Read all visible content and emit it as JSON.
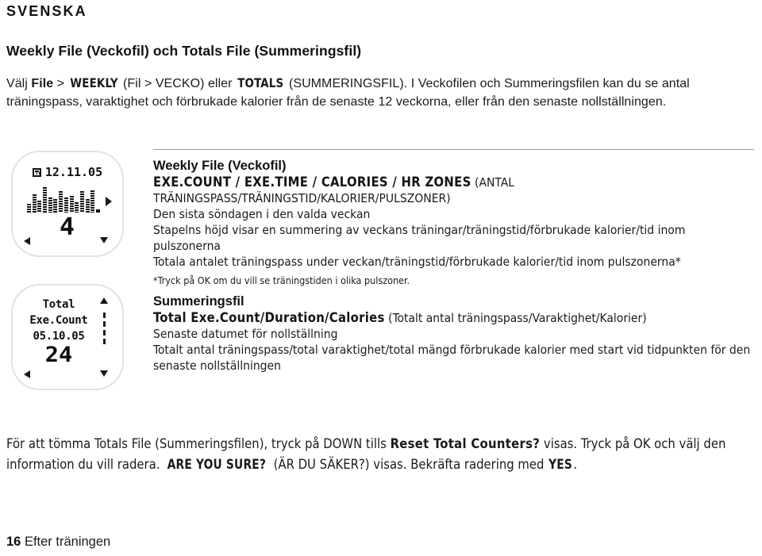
{
  "language_header": "SVENSKA",
  "section_title": "Weekly File (Veckofil) och Totals File (Summeringsfil)",
  "intro": {
    "p1_a": "Välj ",
    "p1_file": "File",
    "p1_gt": " > ",
    "p1_weekly": "WEEKLY",
    "p1_b": " (Fil > VECKO) eller ",
    "p1_totals": "TOTALS",
    "p1_c": " (SUMMERINGSFIL). I Veckofilen och Summeringsfilen kan du se antal träningspass, varaktighet och förbrukade kalorier från de senaste 12 veckorna, eller från den senaste nollställningen."
  },
  "watch_weekly": {
    "date": "12.11.05",
    "calendar_icon": "calendar-icon",
    "value": "4",
    "left_arrow_icon": "arrow-left-icon",
    "down_arrow_icon": "arrow-down-icon",
    "right_arrow_icon": "arrow-right-icon",
    "bars": [
      8,
      17,
      11,
      24,
      14,
      13,
      20,
      14,
      16,
      10,
      20,
      13,
      21,
      3
    ]
  },
  "watch_totals": {
    "line1": "Total",
    "line2": "Exe.Count",
    "line3": "05.10.05",
    "value": "24",
    "up_arrow_icon": "arrow-up-icon",
    "down_arrow_icon": "arrow-down-icon",
    "left_arrow_icon": "arrow-left-icon",
    "scroll_indicator": "scroll-dots"
  },
  "weekly_block": {
    "heading": "Weekly File (Veckofil)",
    "modes": "EXE.COUNT / EXE.TIME / CALORIES / HR ZONES",
    "modes_translation_1": " (ANTAL",
    "modes_translation_2": "TRÄNINGSPASS/TRÄNINGSTID/KALORIER/PULSZONER)",
    "line1": "Den sista söndagen i den valda veckan",
    "line2": "Stapelns höjd visar en summering av veckans träningar/träningstid/förbrukade kalorier/tid inom pulszonerna",
    "line3": "Totala antalet träningspass under veckan/träningstid/förbrukade kalorier/tid inom pulszonerna*",
    "note": "*Tryck på OK om du vill se träningstiden i olika pulszoner."
  },
  "totals_block": {
    "heading": "Summeringsfil",
    "modes": "Total Exe.Count/Duration/Calories",
    "modes_translation": " (Totalt antal träningspass/Varaktighet/Kalorier)",
    "line1": "Senaste datumet för nollställning",
    "line2": "Totalt antal träningspass/total varaktighet/total mängd förbrukade kalorier med start vid tidpunkten för den senaste nollställningen"
  },
  "closing": {
    "a": "För att tömma Totals File (Summeringsfilen), tryck på DOWN tills ",
    "reset": "Reset Total Counters?",
    "b": " visas. Tryck på OK och välj den information du vill radera. ",
    "sure": "ARE YOU SURE?",
    "c": " (ÄR DU SÄKER?) visas. Bekräfta radering med ",
    "yes": "YES",
    "d": "."
  },
  "footer": {
    "page_number": "16",
    "chapter": "Efter träningen"
  },
  "colors": {
    "text": "#1b1b1b",
    "heading": "#111111",
    "rule": "#9c9c9c",
    "watch_border": "#e2e2e2",
    "lcd": "#0d0d0d"
  }
}
